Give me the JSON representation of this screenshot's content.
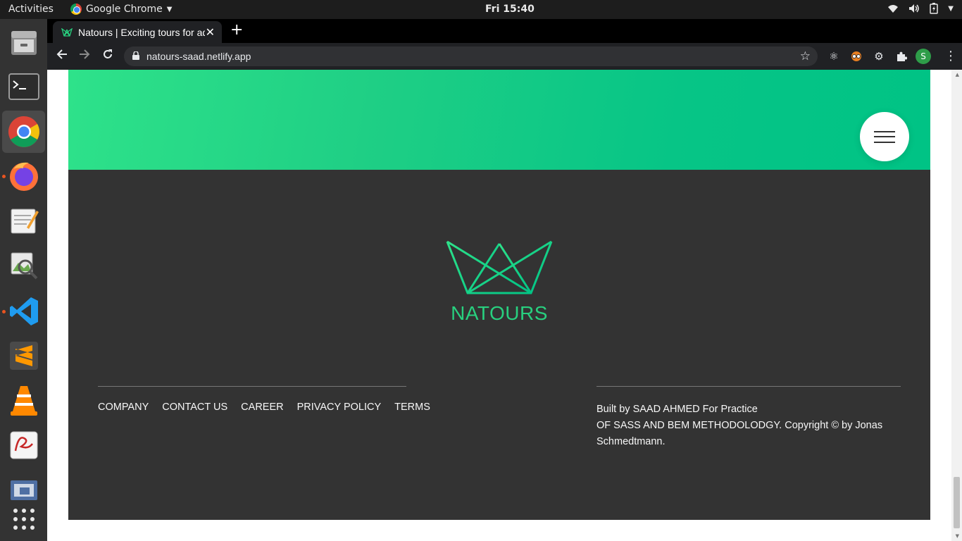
{
  "topbar": {
    "activities": "Activities",
    "app_name": "Google Chrome",
    "clock": "Fri 15:40",
    "status_icons": [
      "wifi-icon",
      "volume-icon",
      "battery-icon",
      "system-menu-icon"
    ]
  },
  "dock": {
    "items": [
      "files",
      "terminal",
      "google-chrome",
      "firefox",
      "text-editor",
      "image-viewer",
      "vscode",
      "sublime-text",
      "vlc",
      "document-viewer",
      "screenshot",
      "show-applications"
    ]
  },
  "browser": {
    "tab_title": "Natours | Exciting tours for adventurous people",
    "url": "natours-saad.netlify.app",
    "profile_initial": "S"
  },
  "page": {
    "logo_text": "NATOURS",
    "nav_links": [
      "COMPANY",
      "CONTACT US",
      "CAREER",
      "PRIVACY POLICY",
      "TERMS"
    ],
    "copyright_line1": "Built by SAAD AHMED For Practice",
    "copyright_line2": "OF SASS AND BEM METHODOLODGY. Copyright © by Jonas Schmedtmann.",
    "colors": {
      "green_light": "#2ee28a",
      "green_dark": "#00c385",
      "footer_bg": "#333333",
      "logo": "#28d07f"
    }
  }
}
